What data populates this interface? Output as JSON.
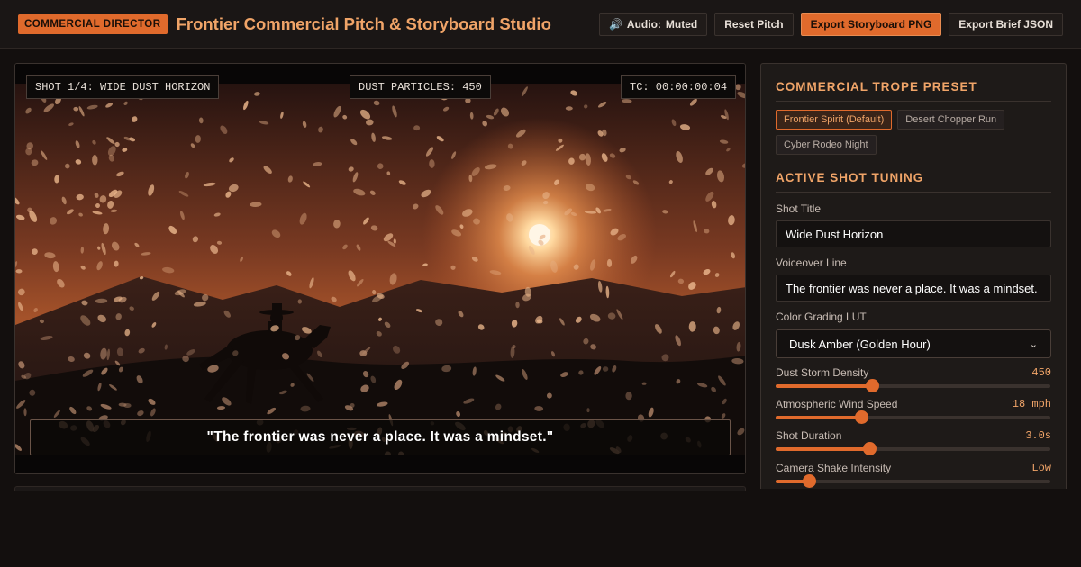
{
  "header": {
    "role_badge": "COMMERCIAL DIRECTOR",
    "title": "Frontier Commercial Pitch & Storyboard Studio",
    "audio_label": "Audio:",
    "audio_state": "Muted",
    "reset_label": "Reset Pitch",
    "export_png_label": "Export Storyboard PNG",
    "export_json_label": "Export Brief JSON"
  },
  "preview": {
    "shot_label": "SHOT 1/4: WIDE DUST HORIZON",
    "particles_label": "DUST PARTICLES: 450",
    "timecode_label": "TC: 00:00:00:04",
    "caption": "\"The frontier was never a place. It was a mindset.\""
  },
  "presets": {
    "title": "COMMERCIAL TROPE PRESET",
    "items": [
      {
        "label": "Frontier Spirit (Default)",
        "active": true
      },
      {
        "label": "Desert Chopper Run",
        "active": false
      },
      {
        "label": "Cyber Rodeo Night",
        "active": false
      }
    ]
  },
  "tuning": {
    "title": "ACTIVE SHOT TUNING",
    "shot_title_label": "Shot Title",
    "shot_title_value": "Wide Dust Horizon",
    "voiceover_label": "Voiceover Line",
    "voiceover_value": "The frontier was never a place. It was a mindset.",
    "lut_label": "Color Grading LUT",
    "lut_value": "Dusk Amber (Golden Hour)",
    "sliders": [
      {
        "label": "Dust Storm Density",
        "value": "450",
        "fraction": 0.35
      },
      {
        "label": "Atmospheric Wind Speed",
        "value": "18 mph",
        "fraction": 0.31
      },
      {
        "label": "Shot Duration",
        "value": "3.0s",
        "fraction": 0.34
      },
      {
        "label": "Camera Shake Intensity",
        "value": "Low",
        "fraction": 0.12
      }
    ]
  },
  "colors": {
    "accent": "#e06a2c",
    "accent_text": "#f0a468",
    "sky_top": "#2a1410",
    "sky_glow": "#e07a3a"
  }
}
